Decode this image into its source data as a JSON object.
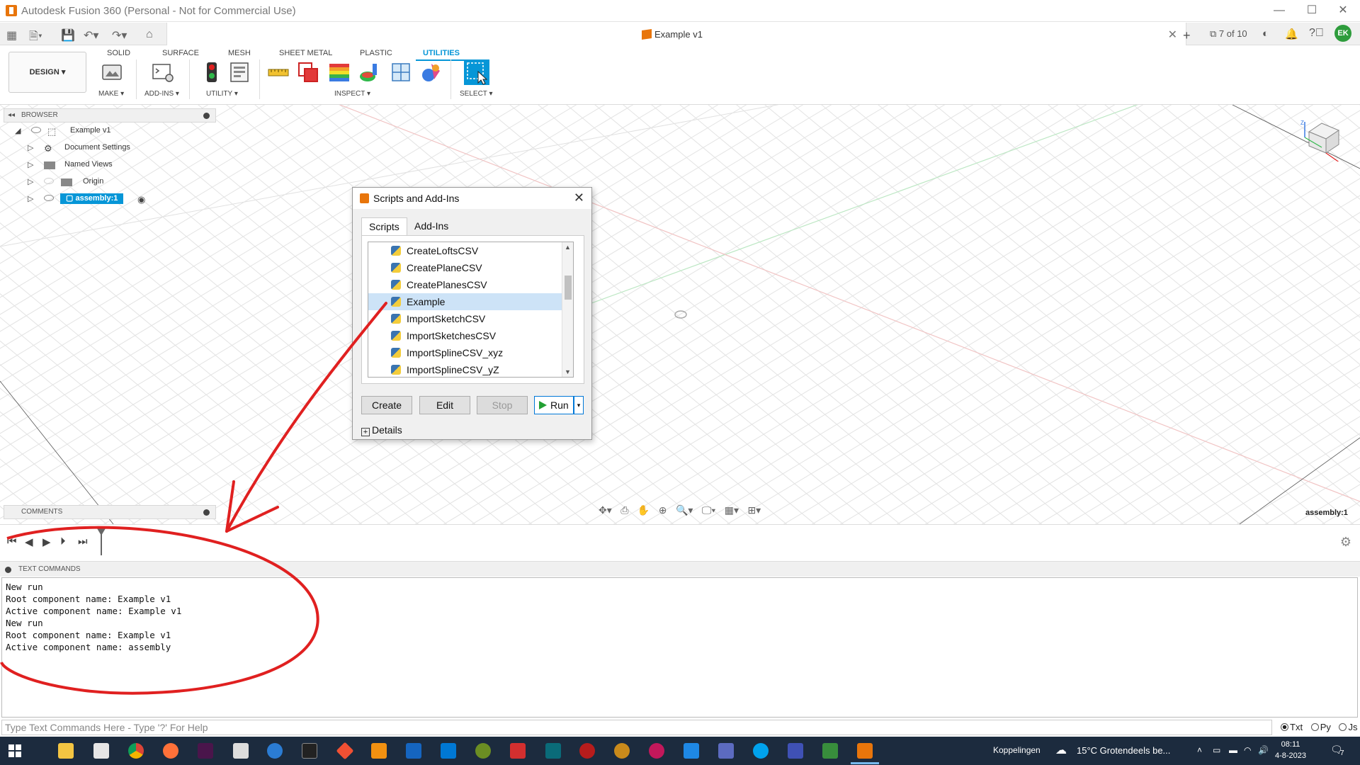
{
  "window": {
    "title": "Autodesk Fusion 360 (Personal - Not for Commercial Use)"
  },
  "document": {
    "title": "Example v1",
    "counter": "7 of 10",
    "user_initials": "EK"
  },
  "ribbon": {
    "workspace": "DESIGN ▾",
    "tabs": [
      "SOLID",
      "SURFACE",
      "MESH",
      "SHEET METAL",
      "PLASTIC",
      "UTILITIES"
    ],
    "active_tab": "UTILITIES",
    "groups": {
      "make": "MAKE ▾",
      "addins": "ADD-INS ▾",
      "utility": "UTILITY ▾",
      "inspect": "INSPECT ▾",
      "select": "SELECT ▾"
    }
  },
  "browser": {
    "header": "BROWSER",
    "items": [
      {
        "label": "Example v1"
      },
      {
        "label": "Document Settings"
      },
      {
        "label": "Named Views"
      },
      {
        "label": "Origin"
      },
      {
        "label": "assembly:1"
      }
    ]
  },
  "comments": {
    "header": "COMMENTS"
  },
  "viewport": {
    "active_component": "assembly:1"
  },
  "dialog": {
    "title": "Scripts and Add-Ins",
    "tabs": [
      "Scripts",
      "Add-Ins"
    ],
    "scripts": [
      "CreateLoftsCSV",
      "CreatePlaneCSV",
      "CreatePlanesCSV",
      "Example",
      "ImportSketchCSV",
      "ImportSketchesCSV",
      "ImportSplineCSV_xyz",
      "ImportSplineCSV_yZ"
    ],
    "selected": "Example",
    "buttons": {
      "create": "Create",
      "edit": "Edit",
      "stop": "Stop",
      "run": "Run"
    },
    "details": "Details"
  },
  "text_commands": {
    "header": "TEXT COMMANDS",
    "output": "New run\nRoot component name: Example v1\nActive component name: Example v1\nNew run\nRoot component name: Example v1\nActive component name: assembly",
    "placeholder": "Type Text Commands Here - Type '?' For Help",
    "modes": [
      "Txt",
      "Py",
      "Js"
    ],
    "active_mode": "Txt"
  },
  "taskbar": {
    "links": "Koppelingen",
    "weather": "15°C  Grotendeels be...",
    "time": "08:11",
    "date": "4-8-2023",
    "notifications": "7"
  },
  "colors": {
    "accent": "#0696d7",
    "fusion_orange": "#e8750b",
    "annotation_red": "#e02020",
    "taskbar": "#1c2b3e"
  }
}
